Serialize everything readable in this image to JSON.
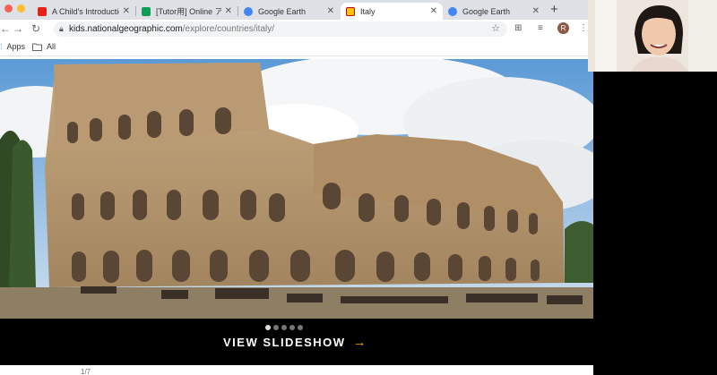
{
  "browser": {
    "tabs": [
      {
        "title": "A Child's Introductio",
        "favicon": "youtube-icon",
        "color": "#e62117",
        "active": false
      },
      {
        "title": "[Tutor用] Online ア",
        "favicon": "sheets-icon",
        "color": "#0f9d58",
        "active": false
      },
      {
        "title": "Google Earth",
        "favicon": "google-earth-icon",
        "color": "#4285f4",
        "active": false
      },
      {
        "title": "Italy",
        "favicon": "natgeo-icon",
        "color": "#f7c600",
        "active": true
      },
      {
        "title": "Google Earth",
        "favicon": "google-earth-icon",
        "color": "#4285f4",
        "active": false
      }
    ],
    "new_tab": "+",
    "url_host": "kids.nationalgeographic.com",
    "url_path": "/explore/countries/italy/",
    "profile_initial": "R",
    "bookmarks": [
      {
        "label": "Apps",
        "icon": "apps-grid-icon"
      },
      {
        "label": "All",
        "icon": "folder-icon"
      }
    ]
  },
  "slideshow": {
    "total_dots": 5,
    "active_dot": 1,
    "label": "VIEW SLIDESHOW",
    "arrow": "→",
    "counter": "1/7",
    "arrow_color": "#f0a500"
  }
}
